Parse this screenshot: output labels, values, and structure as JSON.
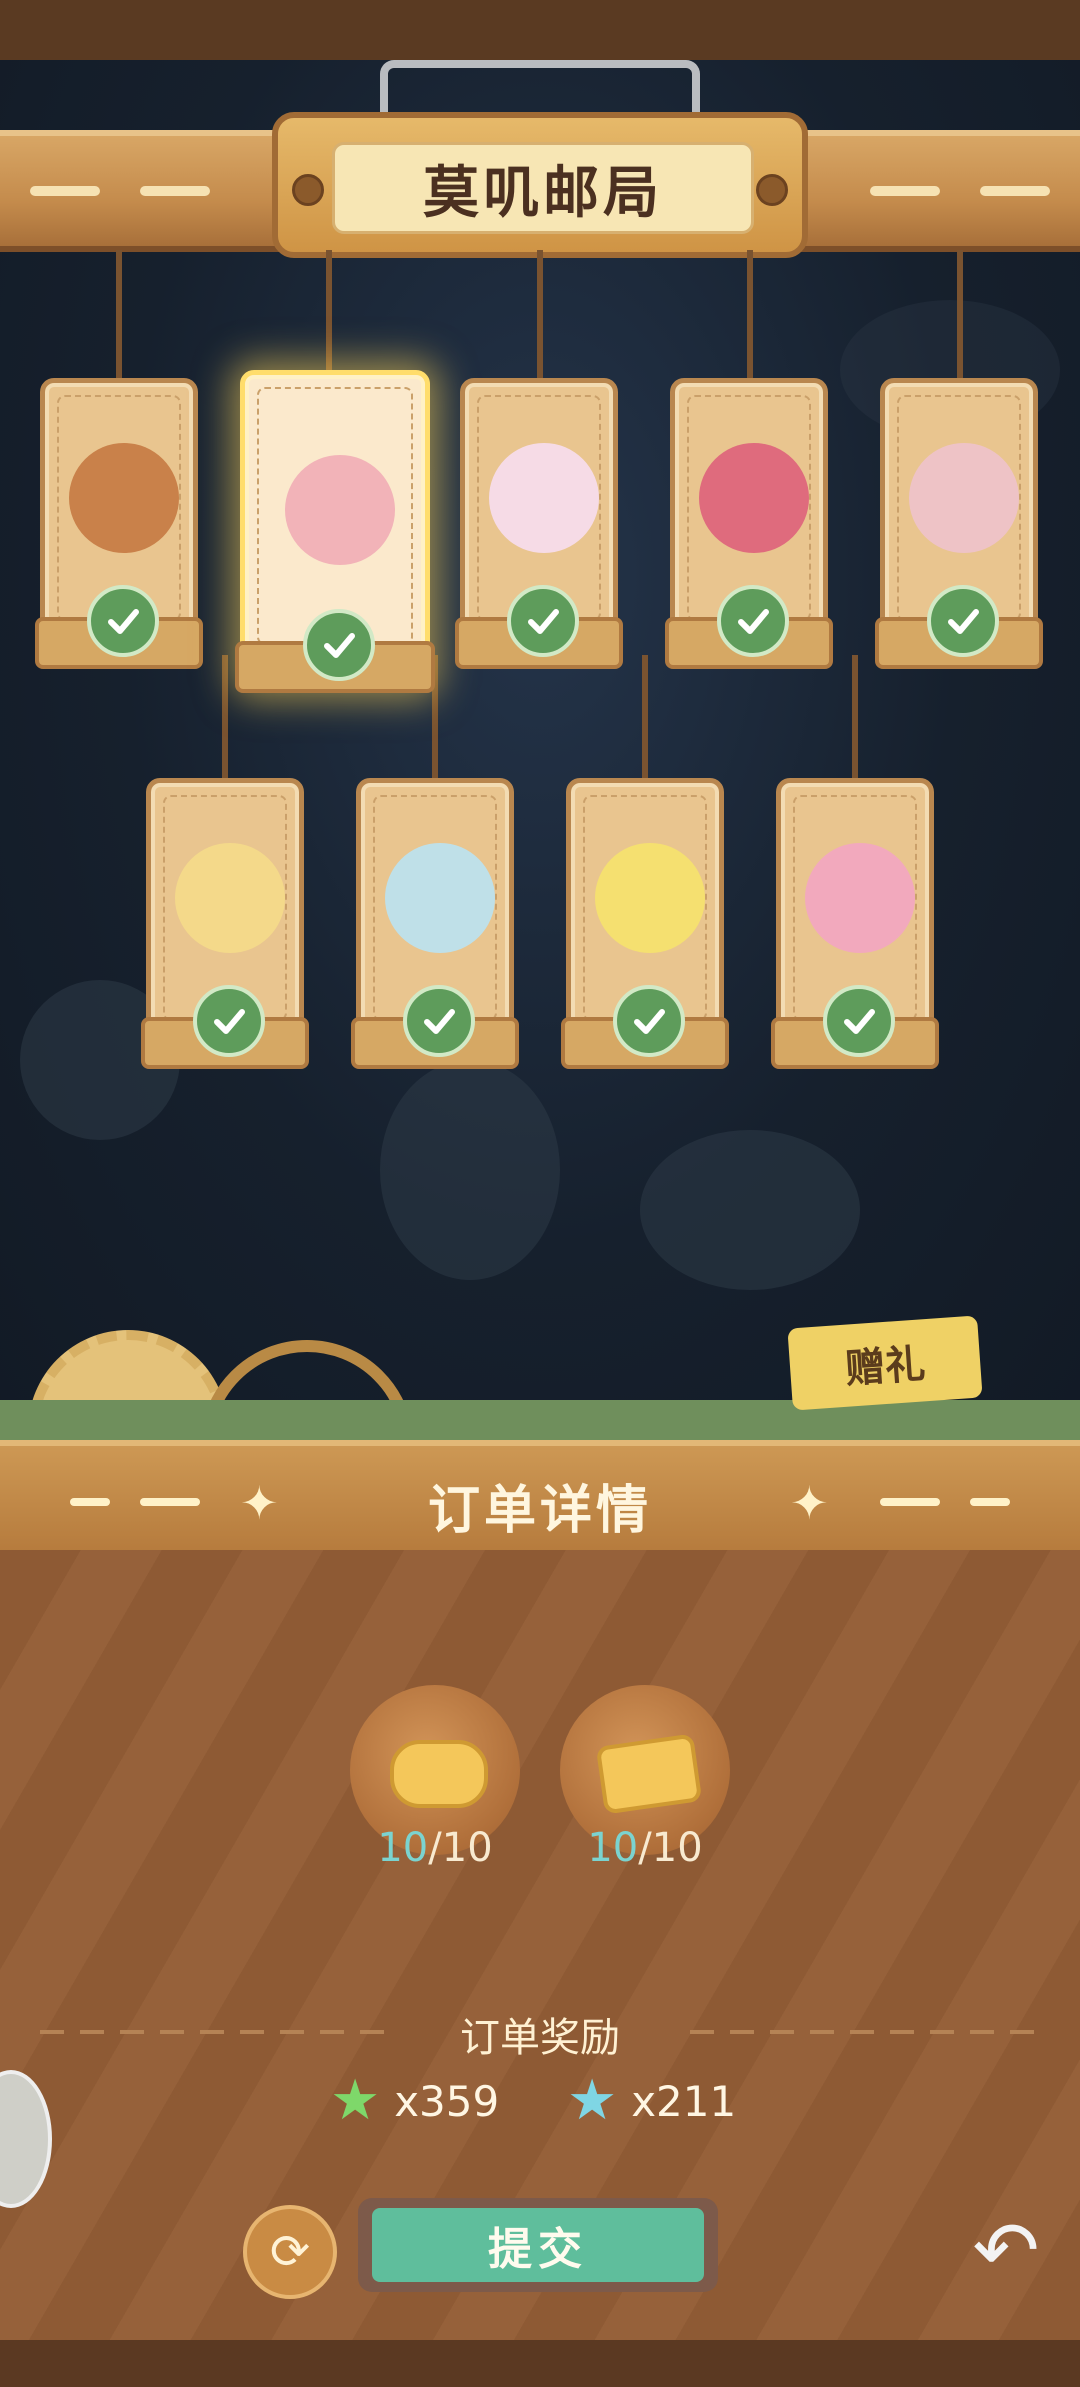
{
  "header": {
    "title": "莫叽邮局"
  },
  "characters": [
    {
      "name": "scarecrow-torch",
      "completed": true,
      "selected": false,
      "color": "#c9814a"
    },
    {
      "name": "yellow-hat-duck",
      "completed": true,
      "selected": true,
      "color": "#f2b3b8"
    },
    {
      "name": "pink-bunny",
      "completed": true,
      "selected": false,
      "color": "#f6dbe6"
    },
    {
      "name": "red-cat",
      "completed": true,
      "selected": false,
      "color": "#df6b7d"
    },
    {
      "name": "pink-dragon",
      "completed": true,
      "selected": false,
      "color": "#eec3c6"
    },
    {
      "name": "crowned-prince",
      "completed": true,
      "selected": false,
      "color": "#f4d98a"
    },
    {
      "name": "bubble-mouse",
      "completed": true,
      "selected": false,
      "color": "#bfe0e8"
    },
    {
      "name": "glasses-cat",
      "completed": true,
      "selected": false,
      "color": "#f5e070"
    },
    {
      "name": "pink-girl-bow",
      "completed": true,
      "selected": false,
      "color": "#f2a9bd"
    }
  ],
  "gift_button": {
    "label": "赠礼"
  },
  "order": {
    "title": "订单详情",
    "items": [
      {
        "icon": "pastry-icon",
        "have": "10",
        "need": "/10"
      },
      {
        "icon": "cheese-icon",
        "have": "10",
        "need": "/10"
      }
    ],
    "reward_label": "订单奖励",
    "rewards": [
      {
        "icon": "green-star-icon",
        "amount": "x359",
        "color": "#7ed86a"
      },
      {
        "icon": "blue-star-icon",
        "amount": "x211",
        "color": "#7fd6e4"
      }
    ]
  },
  "actions": {
    "submit_label": "提交",
    "refresh_icon": "refresh-icon",
    "back_icon": "back-icon"
  }
}
